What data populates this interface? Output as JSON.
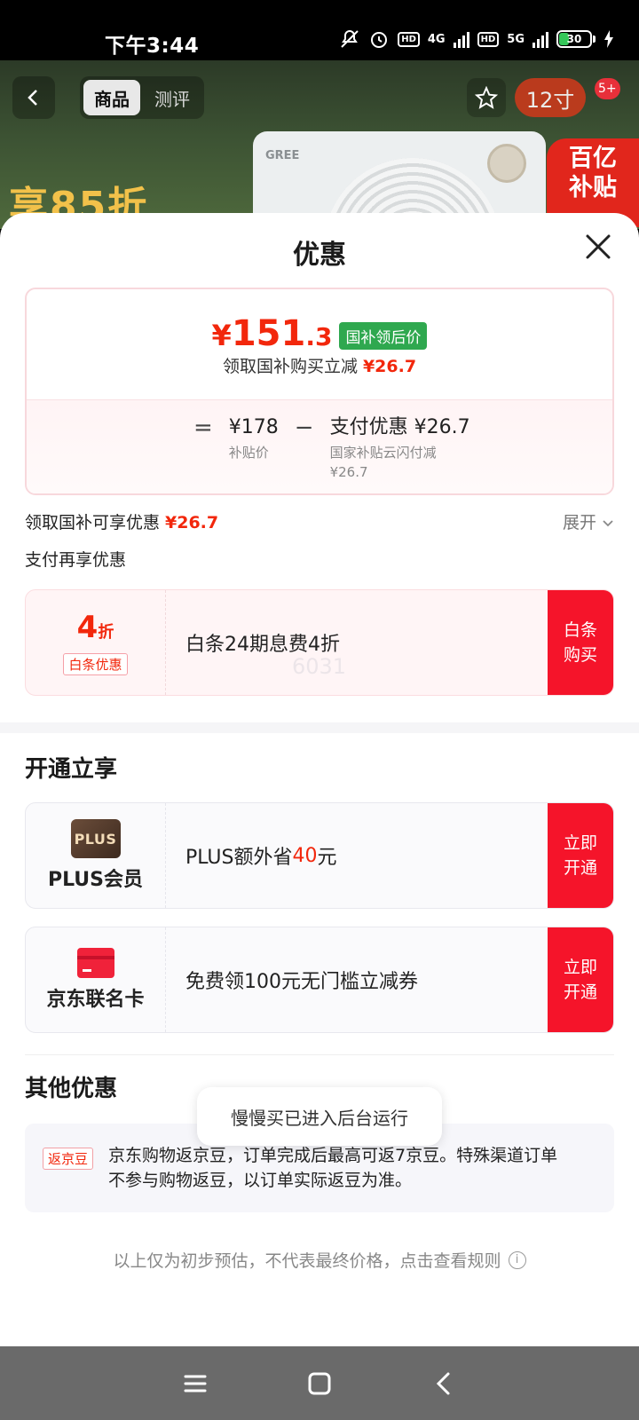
{
  "status_bar": {
    "time": "下午3:44",
    "hd1": "HD",
    "net1": "4G",
    "hd2": "HD",
    "net2": "5G",
    "battery": "30",
    "battery_level": 0.3
  },
  "product_header": {
    "brand": "GREE",
    "promo_text": "享85折",
    "subsidy_line1": "百亿",
    "subsidy_line2": "补贴",
    "tabs": [
      {
        "label": "商品",
        "active": true
      },
      {
        "label": "测评",
        "active": false
      }
    ],
    "share_label": "12寸",
    "badge": "5+"
  },
  "sheet": {
    "title": "优惠",
    "price_card": {
      "currency": "¥",
      "price_int": "151",
      "price_dec": ".3",
      "tag": "国补领后价",
      "claim_text": "领取国补购买立减",
      "claim_amount": "¥26.7",
      "formula": {
        "eq": "=",
        "base_value": "¥178",
        "base_label": "补贴价",
        "minus": "−",
        "discount_value": "支付优惠 ¥26.7",
        "discount_label_1": "国家补贴云闪付减",
        "discount_label_2": "¥26.7"
      }
    },
    "offer_row": {
      "text": "领取国补可享优惠",
      "amount": "¥26.7",
      "expand": "展开"
    },
    "pay_section_title": "支付再享优惠",
    "baitiao": {
      "discount_num": "4",
      "discount_unit": "折",
      "tag": "白条优惠",
      "description": "白条24期息费4折",
      "watermark": "6031",
      "cta": "白条购买"
    },
    "open_section_title": "开通立享",
    "plus": {
      "logo_text": "PLUS",
      "label": "PLUS会员",
      "desc_prefix": "PLUS额外省",
      "desc_amount": "40",
      "desc_suffix": "元",
      "cta": "立即开通"
    },
    "jd_card": {
      "label": "京东联名卡",
      "description": "免费领100元无门槛立减券",
      "cta": "立即开通"
    },
    "other_section_title": "其他优惠",
    "jd_bean": {
      "tag": "返京豆",
      "text": "京东购物返京豆，订单完成后最高可返7京豆。特殊渠道订单不参与购物返豆，以订单实际返豆为准。"
    },
    "toast": "慢慢买已进入后台运行",
    "footnote": "以上仅为初步预估，不代表最终价格，点击查看规则"
  },
  "colors": {
    "accent_red": "#f2270c",
    "cta_red": "#f5142a",
    "green_tag": "#2fa84f"
  }
}
